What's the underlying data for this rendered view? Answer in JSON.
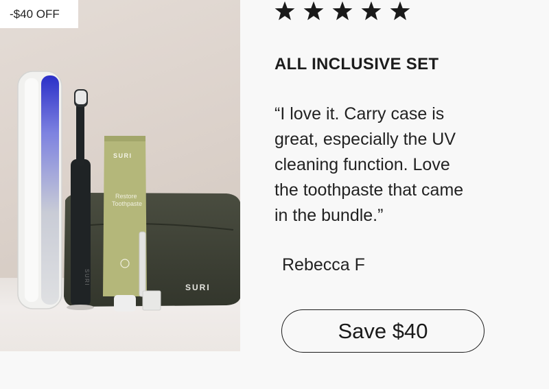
{
  "product": {
    "badge": "-$40 OFF",
    "brand_mark": "SURI",
    "tube_brand": "SURI",
    "tube_line1": "Restore",
    "tube_line2": "Toothpaste",
    "handle_brand": "SURI"
  },
  "review": {
    "rating": 5,
    "stars": [
      "star-icon",
      "star-icon",
      "star-icon",
      "star-icon",
      "star-icon"
    ],
    "title": "ALL INCLUSIVE SET",
    "quote": "“I love it. Carry case is\n  great, especially the UV\n  cleaning function. Love\n  the toothpaste that came\n  in the bundle.”",
    "author": "Rebecca F"
  },
  "cta": {
    "label": "Save $40"
  }
}
